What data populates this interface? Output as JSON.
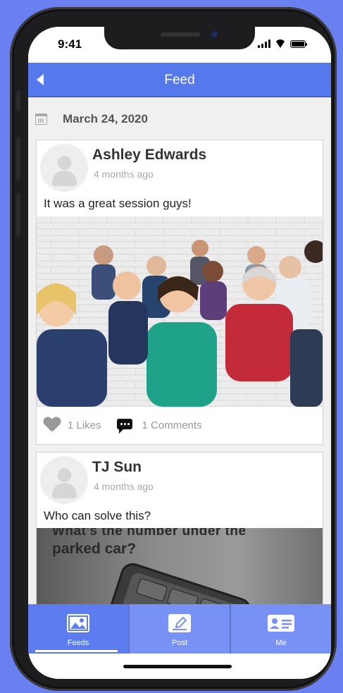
{
  "status_bar": {
    "time": "9:41"
  },
  "nav": {
    "title": "Feed"
  },
  "feed": {
    "date": "March 24, 2020",
    "posts": [
      {
        "author": "Ashley Edwards",
        "time_ago": "4 months ago",
        "text": "It was a great session guys!",
        "likes": "1 Likes",
        "comments": "1 Comments"
      },
      {
        "author": "TJ Sun",
        "time_ago": "4 months ago",
        "text": "Who can solve this?",
        "image_text_top": "What's the number under the",
        "image_text": "parked car?"
      }
    ]
  },
  "tabbar": {
    "active": "Feeds",
    "tabs": [
      {
        "label": "Feeds",
        "icon": "image-icon"
      },
      {
        "label": "Post",
        "icon": "edit-icon"
      },
      {
        "label": "Me",
        "icon": "id-card-icon"
      }
    ]
  },
  "colors": {
    "accent": "#5578ec",
    "tabbar": "#7891f5",
    "background": "#6a7ff0"
  }
}
